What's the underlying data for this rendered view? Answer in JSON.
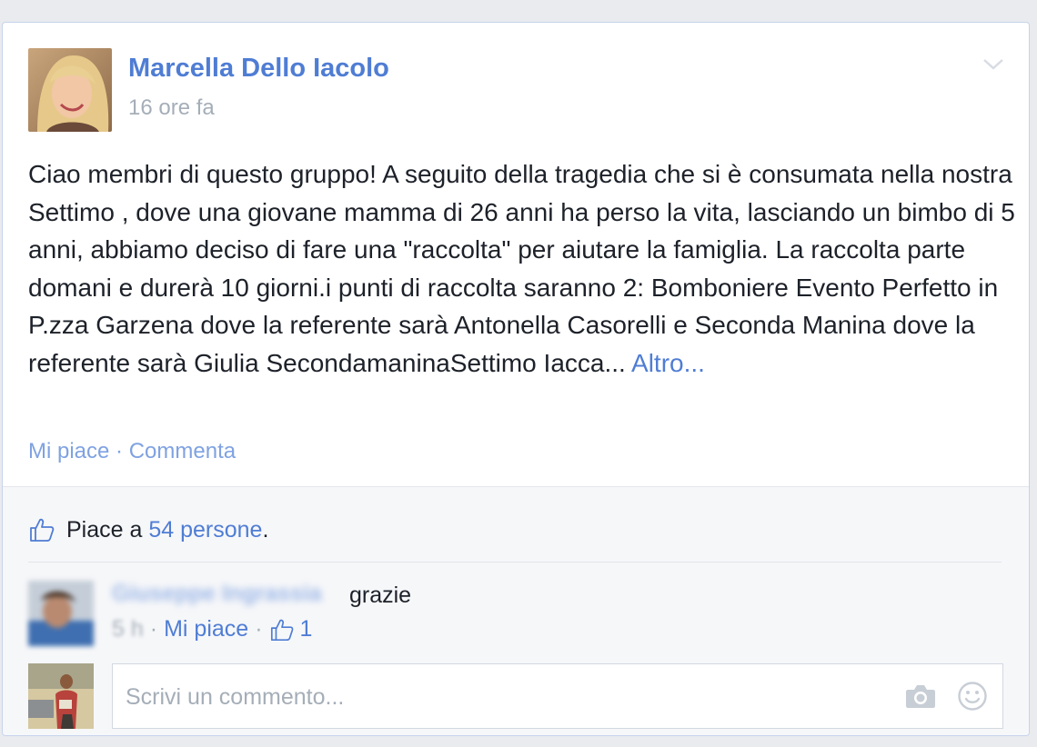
{
  "post": {
    "author": "Marcella Dello Iacolo",
    "time": "16 ore fa",
    "text": "Ciao membri di questo gruppo! A seguito della tragedia che si è consumata nella nostra Settimo , dove una giovane mamma di 26 anni ha perso la vita, lasciando un bimbo di 5 anni, abbiamo deciso di fare una \"raccolta\" per aiutare la famiglia. La raccolta parte domani e durerà 10 giorni.i punti di raccolta saranno 2: Bomboniere Evento Perfetto in P.zza Garzena dove la referente sarà Antonella Casorelli e Seconda Manina dove la referente sarà Giulia SecondamaninaSettimo Iacca...",
    "more_label": "Altro...",
    "chevron_icon": "chevron-down-icon"
  },
  "actions": {
    "like_label": "Mi piace",
    "separator": "·",
    "comment_label": "Commenta"
  },
  "likes": {
    "prefix": "Piace a",
    "count_label": "54 persone",
    "suffix": ".",
    "icon": "thumbs-up-icon"
  },
  "comment": {
    "author": "Giuseppe Ingrassia",
    "text": "grazie",
    "time": "5 h",
    "separator": "·",
    "like_label": "Mi piace",
    "like_count": "1",
    "icon": "thumbs-up-icon"
  },
  "composer": {
    "placeholder": "Scrivi un commento...",
    "camera_icon": "camera-icon",
    "emoji_icon": "smiley-icon"
  },
  "colors": {
    "link": "#4f7dd4",
    "muted": "#a5aeb8",
    "text": "#1d2129",
    "border": "#c7d3ec"
  }
}
